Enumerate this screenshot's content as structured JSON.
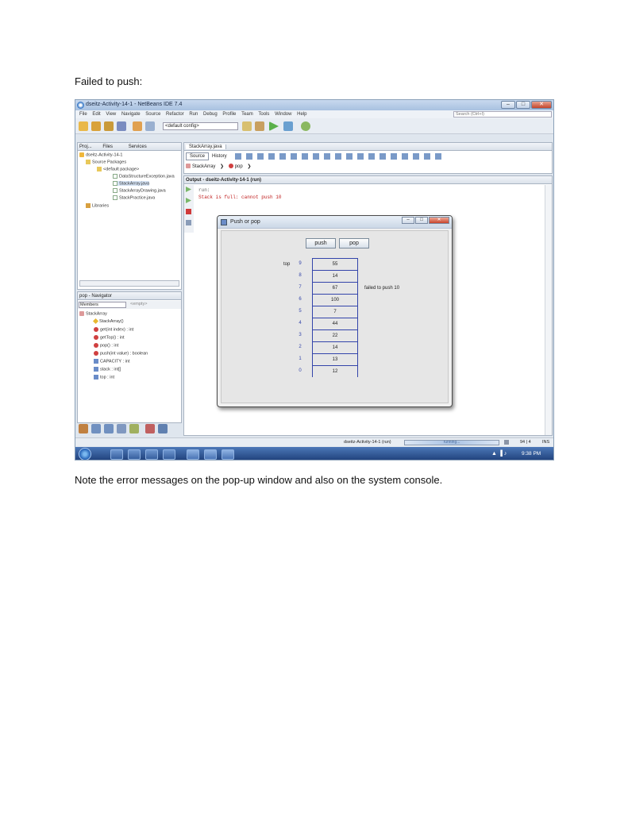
{
  "doc": {
    "heading": "Failed to push:",
    "note": "Note the error messages on the pop-up window and also on the system console."
  },
  "window": {
    "title": "dseitz-Activity-14-1 - NetBeans IDE 7.4",
    "minimize": "–",
    "maximize": "□",
    "close": "✕"
  },
  "menu": [
    "File",
    "Edit",
    "View",
    "Navigate",
    "Source",
    "Refactor",
    "Run",
    "Debug",
    "Profile",
    "Team",
    "Tools",
    "Window",
    "Help"
  ],
  "search": {
    "placeholder": "Search (Ctrl+I)"
  },
  "toolbar": {
    "config": "<default config>"
  },
  "projects_panel": {
    "tabs": [
      "Proj...",
      "Files",
      "Services"
    ],
    "tree": [
      "dseitz-Activity-14-1",
      "Source Packages",
      "<default package>",
      "DataStructureException.java",
      "StackArray.java",
      "StackArrayDrawing.java",
      "StackPractice.java",
      "Libraries"
    ]
  },
  "navigator": {
    "title": "pop - Navigator",
    "filter": "Members",
    "filter_value": "<empty>",
    "items": [
      "StackArray",
      "StackArray()",
      "get(int index) : int",
      "getTop() : int",
      "pop() : int",
      "push(int value) : boolean",
      "CAPACITY : int",
      "stack : int[]",
      "top : int"
    ]
  },
  "editor": {
    "file_tab": "StackArray.java",
    "source_tab": "Source",
    "history_tab": "History",
    "breadcrumb_class": "StackArray",
    "breadcrumb_method": "pop"
  },
  "output": {
    "title": "Output - dseitz-Activity-14-1 (run)",
    "lines": [
      "run:",
      "Stack is full: cannot push 10"
    ]
  },
  "dialog": {
    "title": "Push or pop",
    "push_label": "push",
    "pop_label": "pop",
    "top_label": "top",
    "message": "failed to push 10",
    "indices": [
      "9",
      "8",
      "7",
      "6",
      "5",
      "4",
      "3",
      "2",
      "1",
      "0"
    ],
    "values": [
      "55",
      "14",
      "67",
      "100",
      "7",
      "44",
      "22",
      "14",
      "13",
      "12"
    ]
  },
  "status": {
    "task": "dseitz-Activity-14-1 (run)",
    "progress_text": "running...",
    "position": "94 | 4",
    "mode": "INS"
  },
  "taskbar": {
    "clock": "9:38 PM"
  }
}
